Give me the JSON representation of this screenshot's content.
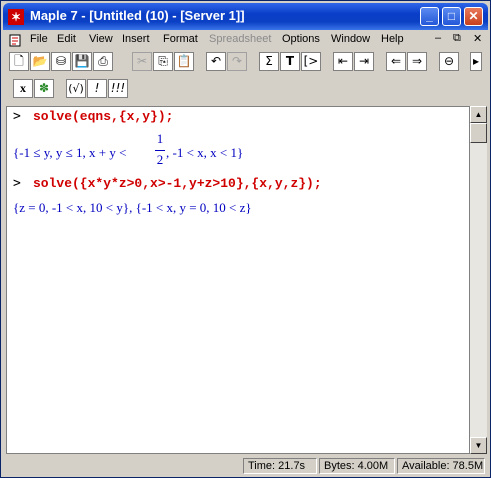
{
  "window": {
    "title": "Maple 7  - [Untitled (10) - [Server 1]]"
  },
  "menu": [
    "File",
    "Edit",
    "View",
    "Insert",
    "Format",
    "Spreadsheet",
    "Options",
    "Window",
    "Help"
  ],
  "toolbar2": {
    "x_label": "x",
    "eval_label": "(√)",
    "bang_label": "!",
    "bangs_label": "!!!"
  },
  "worksheet": {
    "prompt": ">",
    "cmd1": "solve(eqns,{x,y});",
    "out1_left": "{-1 ≤ y, y ≤ 1, x + y < ",
    "out1_num": "1",
    "out1_den": "2",
    "out1_right": ", -1 < x, x < 1}",
    "cmd2": "solve({x*y*z>0,x>-1,y+z>10},{x,y,z});",
    "out2": "{z = 0, -1 < x, 10 < y}, {-1 < x, y = 0, 10 < z}"
  },
  "status": {
    "time": "Time:  21.7s",
    "bytes": "Bytes: 4.00M",
    "available": "Available:  78.5M"
  },
  "colors": {
    "titlebar": "#0b40c4",
    "command": "#d00000",
    "output": "#0000c0"
  }
}
